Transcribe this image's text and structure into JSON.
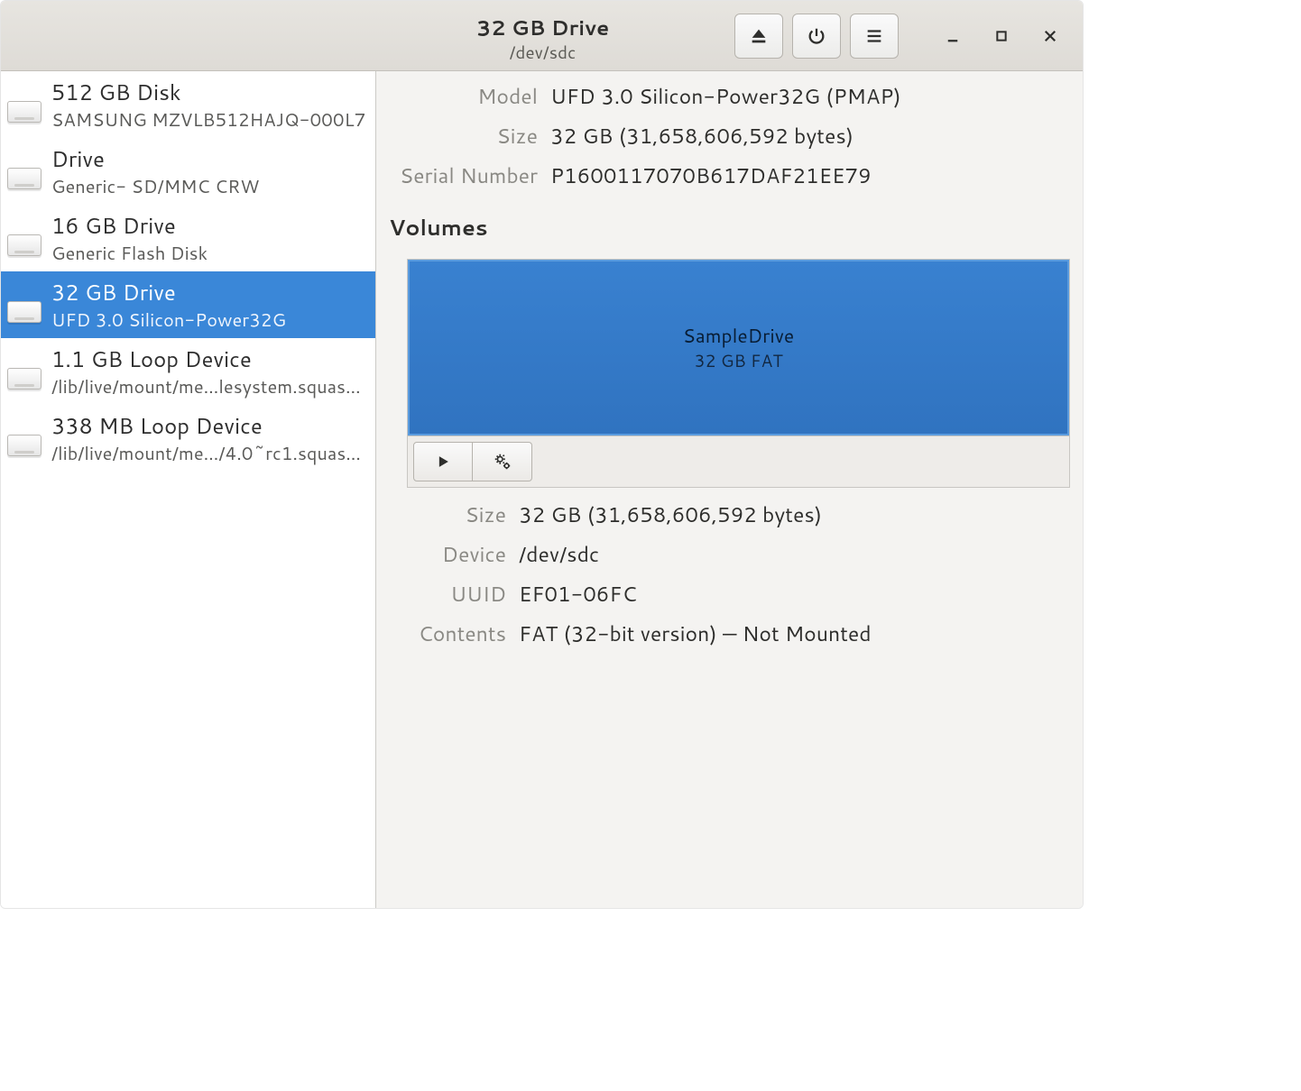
{
  "header": {
    "title": "32 GB Drive",
    "subtitle": "/dev/sdc"
  },
  "sidebar": {
    "items": [
      {
        "title": "512 GB Disk",
        "sub": "SAMSUNG MZVLB512HAJQ-000L7",
        "selected": false
      },
      {
        "title": "Drive",
        "sub": "Generic- SD/MMC CRW",
        "selected": false
      },
      {
        "title": "16 GB Drive",
        "sub": "Generic Flash Disk",
        "selected": false
      },
      {
        "title": "32 GB Drive",
        "sub": "UFD 3.0 Silicon-Power32G",
        "selected": true
      },
      {
        "title": "1.1 GB Loop Device",
        "sub": "/lib/live/mount/me…lesystem.squashfs",
        "selected": false
      },
      {
        "title": "338 MB Loop Device",
        "sub": "/lib/live/mount/me…/4.0~rc1.squashfs",
        "selected": false
      }
    ]
  },
  "drive_info": {
    "model_label": "Model",
    "model_value": "UFD 3.0 Silicon-Power32G (PMAP)",
    "size_label": "Size",
    "size_value": "32 GB (31,658,606,592 bytes)",
    "serial_label": "Serial Number",
    "serial_value": "P1600117070B617DAF21EE79"
  },
  "volumes": {
    "heading": "Volumes",
    "partition": {
      "name": "SampleDrive",
      "sub": "32 GB FAT"
    },
    "details": {
      "size_label": "Size",
      "size_value": "32 GB (31,658,606,592 bytes)",
      "device_label": "Device",
      "device_value": "/dev/sdc",
      "uuid_label": "UUID",
      "uuid_value": "EF01-06FC",
      "contents_label": "Contents",
      "contents_value": "FAT (32-bit version) — Not Mounted"
    }
  }
}
